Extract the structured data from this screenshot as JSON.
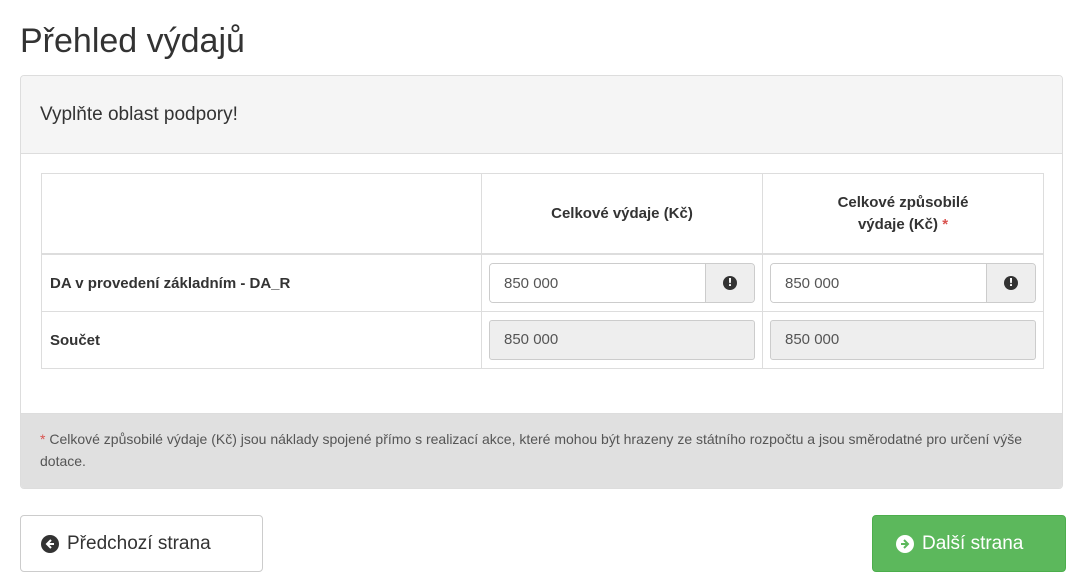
{
  "page": {
    "title": "Přehled výdajů"
  },
  "panel": {
    "heading": "Vyplňte oblast podpory!"
  },
  "table": {
    "headers": {
      "col1": "",
      "col2": "Celkové výdaje (Kč)",
      "col3_line1": "Celkové způsobilé",
      "col3_line2": "výdaje (Kč)",
      "required_mark": "*"
    },
    "rows": [
      {
        "label": "DA v provedení základním - DA_R",
        "total": "850 000",
        "eligible": "850 000"
      },
      {
        "label": "Součet",
        "total": "850 000",
        "eligible": "850 000"
      }
    ]
  },
  "footer": {
    "required_mark": "*",
    "note": " Celkové způsobilé výdaje (Kč) jsou náklady spojené přímo s realizací akce, které mohou být hrazeny ze státního rozpočtu a jsou směrodatné pro určení výše dotace."
  },
  "buttons": {
    "prev_label": "Předchozí strana",
    "next_label": "Další strana"
  },
  "icons": {
    "info": "info-circle-icon",
    "prev": "arrow-circle-left-icon",
    "next": "arrow-circle-right-icon"
  },
  "colors": {
    "success": "#5cb85c",
    "required": "#d9534f",
    "footer_bg": "#e0e0e0"
  }
}
